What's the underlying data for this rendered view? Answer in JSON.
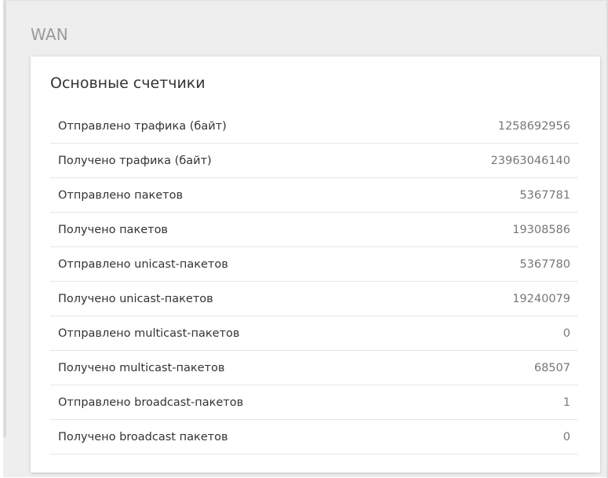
{
  "section": {
    "title": "WAN"
  },
  "card": {
    "title": "Основные счетчики",
    "rows": [
      {
        "label": "Отправлено трафика (байт)",
        "value": "1258692956"
      },
      {
        "label": "Получено трафика (байт)",
        "value": "23963046140"
      },
      {
        "label": "Отправлено пакетов",
        "value": "5367781"
      },
      {
        "label": "Получено пакетов",
        "value": "19308586"
      },
      {
        "label": "Отправлено unicast-пакетов",
        "value": "5367780"
      },
      {
        "label": "Получено unicast-пакетов",
        "value": "19240079"
      },
      {
        "label": "Отправлено multicast-пакетов",
        "value": "0"
      },
      {
        "label": "Получено multicast-пакетов",
        "value": "68507"
      },
      {
        "label": "Отправлено broadcast-пакетов",
        "value": "1"
      },
      {
        "label": "Получено broadcast пакетов",
        "value": "0"
      }
    ]
  }
}
